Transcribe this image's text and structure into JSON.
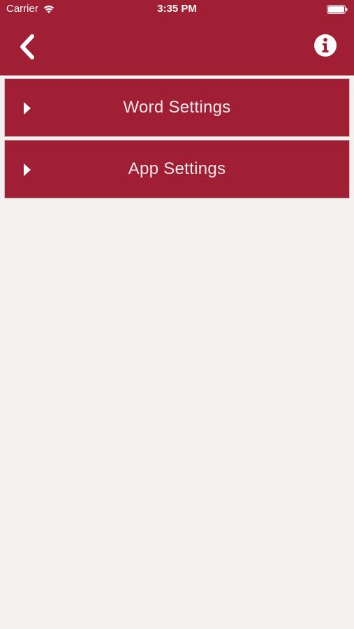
{
  "status_bar": {
    "carrier": "Carrier",
    "time": "3:35 PM",
    "wifi_icon": "wifi-icon",
    "battery_icon": "battery-icon"
  },
  "nav": {
    "back_icon": "chevron-left-icon",
    "info_icon": "info-icon"
  },
  "menu": {
    "items": [
      {
        "label": "Word Settings",
        "icon": "caret-right-icon"
      },
      {
        "label": "App Settings",
        "icon": "caret-right-icon"
      }
    ]
  },
  "colors": {
    "accent": "#a01f35",
    "background": "#f5f0f0",
    "text_on_accent": "#f3e7e9"
  }
}
